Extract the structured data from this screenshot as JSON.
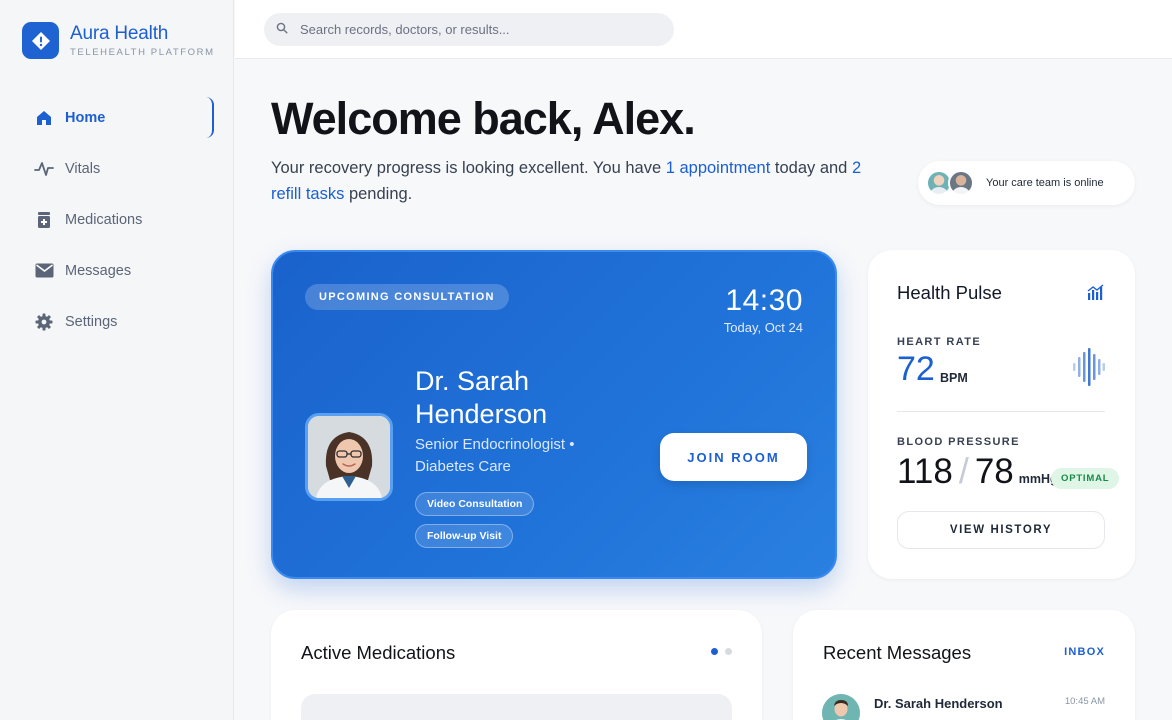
{
  "brand": {
    "name": "Aura Health",
    "subtitle": "TELEHEALTH PLATFORM",
    "accent": "#1c5fd1"
  },
  "sidebar": {
    "items": [
      {
        "label": "Home",
        "icon": "home-icon",
        "active": true
      },
      {
        "label": "Vitals",
        "icon": "pulse-icon",
        "active": false
      },
      {
        "label": "Medications",
        "icon": "pill-bottle-icon",
        "active": false
      },
      {
        "label": "Messages",
        "icon": "envelope-icon",
        "active": false
      },
      {
        "label": "Settings",
        "icon": "gear-icon",
        "active": false
      }
    ]
  },
  "search": {
    "placeholder": "Search records, doctors, or results...",
    "value": ""
  },
  "welcome": {
    "title": "Welcome back, Alex.",
    "sub_part1": "Your recovery progress is looking excellent. You have ",
    "appointment_link": "1 appointment",
    "sub_part2": " today and ",
    "refill_link": "2 refill tasks",
    "sub_part3": " pending."
  },
  "care_team": {
    "status": "Your care team is online"
  },
  "consultation": {
    "badge": "UPCOMING CONSULTATION",
    "time": "14:30",
    "date": "Today, Oct 24",
    "doctor_name": "Dr. Sarah Henderson",
    "specialty": "Senior Endocrinologist • Diabetes Care",
    "tags": [
      "Video Consultation",
      "Follow-up Visit"
    ],
    "join_label": "JOIN ROOM"
  },
  "health_pulse": {
    "title": "Health Pulse",
    "heart_rate_label": "HEART RATE",
    "heart_rate_value": "72",
    "heart_rate_unit": "BPM",
    "bp_label": "BLOOD PRESSURE",
    "bp_systolic": "118",
    "bp_diastolic": "78",
    "bp_unit": "mmHg",
    "bp_status": "OPTIMAL",
    "history_label": "VIEW HISTORY"
  },
  "medications": {
    "title": "Active Medications",
    "page_dots": 2,
    "active_dot": 0
  },
  "messages": {
    "title": "Recent Messages",
    "inbox_label": "INBOX",
    "items": [
      {
        "sender": "Dr. Sarah Henderson",
        "time": "10:45 AM"
      }
    ]
  }
}
